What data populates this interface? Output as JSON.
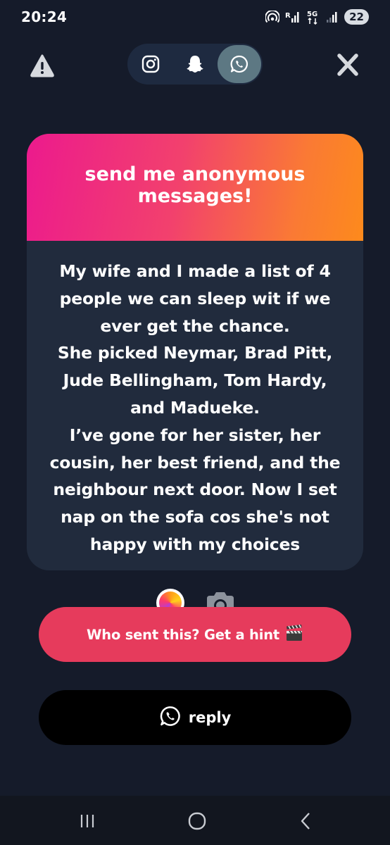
{
  "status_bar": {
    "time": "20:24",
    "network_label": "5G",
    "battery": "22"
  },
  "share": {
    "platforms": [
      {
        "name": "instagram",
        "icon": "instagram-icon",
        "active": false
      },
      {
        "name": "snapchat",
        "icon": "snapchat-icon",
        "active": false
      },
      {
        "name": "whatsapp",
        "icon": "whatsapp-icon",
        "active": true
      }
    ]
  },
  "card": {
    "title": "send me anonymous messages!",
    "message": "My wife and I made a list of 4\npeople we can sleep wit if we\never get the chance.\nShe picked Neymar, Brad Pitt,\nJude Bellingham, Tom Hardy,\nand Madueke.\nI’ve gone for her sister, her\ncousin, her best friend, and the\nneighbour next door. Now I set\nnap on the sofa cos she's not\nhappy with my choices"
  },
  "actions": {
    "hint_label": "Who sent this? Get a hint",
    "hint_emoji": "🎬",
    "reply_label": "reply"
  },
  "colors": {
    "background": "#151b2a",
    "card_body": "#212b3d",
    "gradient_start": "#ec1a8d",
    "gradient_end": "#fd8a1c",
    "hint_button": "#e63b5c",
    "whatsapp_active": "#5d7883"
  },
  "icons": {
    "top_left": "warning-icon",
    "top_right": "close-icon",
    "nav": [
      "recents-icon",
      "home-icon",
      "back-icon"
    ]
  }
}
